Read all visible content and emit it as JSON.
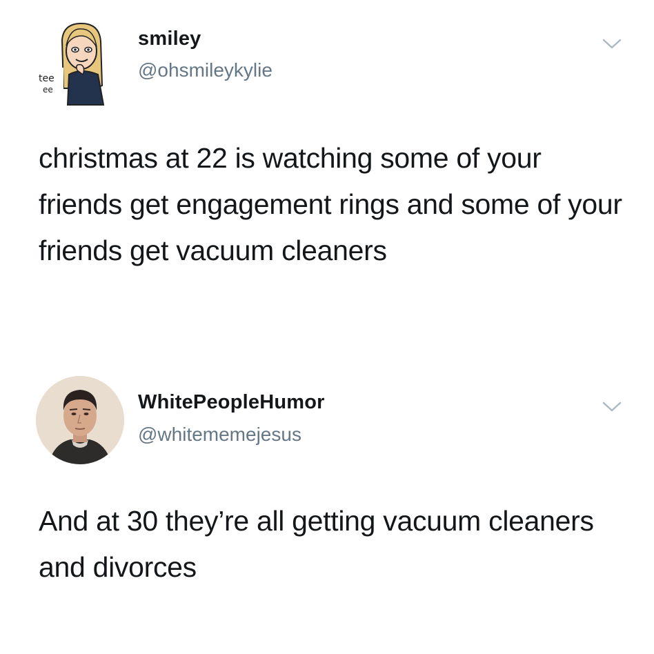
{
  "tweets": [
    {
      "display_name": "smiley",
      "handle": "@ohsmileykylie",
      "avatar_icon": "bitmoji-avatar-icon",
      "avatar_text": "tee ee",
      "menu_icon": "chevron-down-icon",
      "text": "christmas at 22 is watching some of your friends get engagement rings and some of your friends get vacuum cleaners"
    },
    {
      "display_name": "WhitePeopleHumor",
      "handle": "@whitememejesus",
      "avatar_icon": "profile-photo-icon",
      "menu_icon": "chevron-down-icon",
      "text": "And at 30 they’re all getting vacuum cleaners and divorces"
    }
  ],
  "colors": {
    "text": "#14171a",
    "secondary": "#657786",
    "chevron": "#aab8c2"
  }
}
